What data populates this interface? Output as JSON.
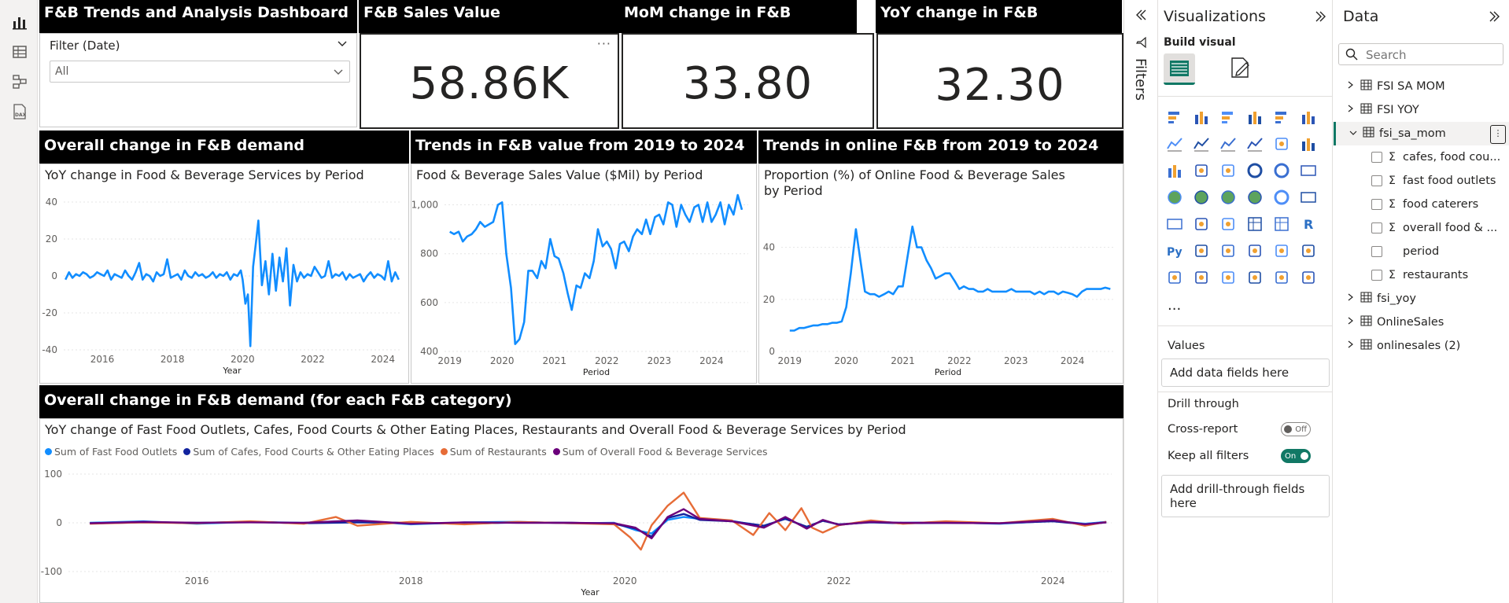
{
  "rail": {
    "icons": [
      "report-view-icon",
      "table-view-icon",
      "model-view-icon",
      "dax-query-icon"
    ]
  },
  "header": {
    "dashboard_title": "F&B Trends and Analysis Dashboard",
    "kpi1_title": "F&B Sales Value",
    "kpi2_title": "MoM change in F&B",
    "kpi3_title": "YoY change in F&B"
  },
  "filter": {
    "label": "Filter (Date)",
    "value": "All"
  },
  "kpis": {
    "sales_value": "58.86K",
    "mom": "33.80",
    "yoy": "32.30"
  },
  "sections": {
    "s1": "Overall change in F&B demand",
    "s2": "Trends in F&B value from 2019 to 2024",
    "s3": "Trends in online F&B from 2019 to 2024",
    "s4": "Overall change in F&B demand (for each F&B category)"
  },
  "chart_data": [
    {
      "type": "line",
      "title": "YoY change in Food & Beverage Services by Period",
      "xlabel": "Year",
      "ylabel": "",
      "x_ticks": [
        "2016",
        "2018",
        "2020",
        "2022",
        "2024"
      ],
      "y_ticks": [
        40,
        20,
        0,
        -20,
        -40
      ],
      "xlim": [
        2014.9,
        2024.5
      ],
      "ylim": [
        -40,
        40
      ],
      "grid": true,
      "series": [
        {
          "color": "#118DFF",
          "x": [
            2014.95,
            2015.05,
            2015.15,
            2015.25,
            2015.35,
            2015.45,
            2015.55,
            2015.65,
            2015.75,
            2015.85,
            2015.95,
            2016.05,
            2016.15,
            2016.25,
            2016.35,
            2016.45,
            2016.55,
            2016.65,
            2016.75,
            2016.85,
            2016.95,
            2017.05,
            2017.15,
            2017.25,
            2017.35,
            2017.45,
            2017.55,
            2017.65,
            2017.75,
            2017.85,
            2017.95,
            2018.05,
            2018.15,
            2018.25,
            2018.35,
            2018.45,
            2018.55,
            2018.65,
            2018.75,
            2018.85,
            2018.95,
            2019.05,
            2019.15,
            2019.25,
            2019.35,
            2019.45,
            2019.55,
            2019.65,
            2019.75,
            2019.85,
            2019.95,
            2020.0,
            2020.08,
            2020.15,
            2020.22,
            2020.3,
            2020.38,
            2020.45,
            2020.55,
            2020.65,
            2020.75,
            2020.85,
            2020.95,
            2021.05,
            2021.15,
            2021.25,
            2021.35,
            2021.45,
            2021.55,
            2021.65,
            2021.75,
            2021.85,
            2021.95,
            2022.05,
            2022.15,
            2022.25,
            2022.35,
            2022.45,
            2022.55,
            2022.65,
            2022.75,
            2022.85,
            2022.95,
            2023.05,
            2023.15,
            2023.25,
            2023.35,
            2023.45,
            2023.55,
            2023.65,
            2023.75,
            2023.85,
            2023.95,
            2024.05,
            2024.15,
            2024.25,
            2024.35,
            2024.45
          ],
          "y": [
            -2,
            2,
            -1,
            1,
            0,
            2,
            1,
            -1,
            0,
            2,
            1,
            0,
            3,
            -2,
            1,
            0,
            -1,
            3,
            0,
            -2,
            2,
            7,
            -2,
            1,
            0,
            -3,
            2,
            0,
            1,
            9,
            -1,
            0,
            1,
            -2,
            3,
            0,
            -1,
            2,
            0,
            1,
            -1,
            0,
            2,
            -1,
            1,
            0,
            2,
            -2,
            1,
            0,
            3,
            -2,
            -15,
            -10,
            -38,
            5,
            18,
            30,
            -5,
            8,
            -10,
            12,
            -8,
            10,
            -3,
            15,
            -16,
            6,
            -3,
            2,
            -1,
            1,
            0,
            5,
            2,
            -1,
            0,
            8,
            -1,
            1,
            0,
            2,
            -2,
            1,
            -1,
            0,
            1,
            -3,
            0,
            2,
            -1,
            1,
            0,
            -2,
            8,
            -3,
            2,
            -2
          ]
        }
      ]
    },
    {
      "type": "line",
      "title": "Food & Beverage Sales Value ($Mil) by Period",
      "xlabel": "Period",
      "ylabel": "",
      "x_ticks": [
        "2019",
        "2020",
        "2021",
        "2022",
        "2023",
        "2024"
      ],
      "y_ticks": [
        "1,000",
        "800",
        "600",
        "400"
      ],
      "xlim": [
        2018.9,
        2024.7
      ],
      "ylim": [
        400,
        1050
      ],
      "grid": true,
      "series": [
        {
          "color": "#118DFF",
          "x": [
            2019.0,
            2019.08,
            2019.17,
            2019.25,
            2019.33,
            2019.42,
            2019.5,
            2019.58,
            2019.67,
            2019.75,
            2019.83,
            2019.92,
            2020.0,
            2020.08,
            2020.17,
            2020.25,
            2020.33,
            2020.42,
            2020.5,
            2020.58,
            2020.67,
            2020.75,
            2020.83,
            2020.92,
            2021.0,
            2021.08,
            2021.17,
            2021.25,
            2021.33,
            2021.42,
            2021.5,
            2021.58,
            2021.67,
            2021.75,
            2021.83,
            2021.92,
            2022.0,
            2022.08,
            2022.17,
            2022.25,
            2022.33,
            2022.42,
            2022.5,
            2022.58,
            2022.67,
            2022.75,
            2022.83,
            2022.92,
            2023.0,
            2023.08,
            2023.17,
            2023.25,
            2023.33,
            2023.42,
            2023.5,
            2023.58,
            2023.67,
            2023.75,
            2023.83,
            2023.92,
            2024.0,
            2024.08,
            2024.17,
            2024.25,
            2024.33,
            2024.42,
            2024.5,
            2024.58
          ],
          "y": [
            890,
            880,
            890,
            850,
            870,
            880,
            900,
            930,
            910,
            920,
            930,
            1000,
            1010,
            800,
            660,
            430,
            450,
            520,
            730,
            730,
            700,
            770,
            740,
            860,
            790,
            780,
            720,
            640,
            570,
            670,
            660,
            720,
            700,
            770,
            900,
            830,
            850,
            820,
            740,
            840,
            850,
            810,
            870,
            900,
            880,
            940,
            880,
            950,
            960,
            920,
            1010,
            1000,
            910,
            1000,
            960,
            930,
            990,
            1000,
            930,
            1010,
            930,
            960,
            1010,
            920,
            1000,
            960,
            1040,
            980
          ]
        }
      ]
    },
    {
      "type": "line",
      "title": "Proportion (%) of Online Food & Beverage Sales by Period",
      "xlabel": "Period",
      "ylabel": "",
      "x_ticks": [
        "2019",
        "2020",
        "2021",
        "2022",
        "2023",
        "2024"
      ],
      "y_ticks": [
        40,
        20,
        0
      ],
      "xlim": [
        2018.85,
        2024.75
      ],
      "ylim": [
        0,
        55
      ],
      "grid": true,
      "series": [
        {
          "color": "#118DFF",
          "x": [
            2019.0,
            2019.08,
            2019.17,
            2019.25,
            2019.33,
            2019.42,
            2019.5,
            2019.58,
            2019.67,
            2019.75,
            2019.83,
            2019.92,
            2020.0,
            2020.08,
            2020.17,
            2020.25,
            2020.33,
            2020.42,
            2020.5,
            2020.58,
            2020.67,
            2020.75,
            2020.83,
            2020.92,
            2021.0,
            2021.08,
            2021.17,
            2021.25,
            2021.33,
            2021.42,
            2021.5,
            2021.58,
            2021.67,
            2021.75,
            2021.83,
            2021.92,
            2022.0,
            2022.08,
            2022.17,
            2022.25,
            2022.33,
            2022.42,
            2022.5,
            2022.58,
            2022.67,
            2022.75,
            2022.83,
            2022.92,
            2023.0,
            2023.08,
            2023.17,
            2023.25,
            2023.33,
            2023.42,
            2023.5,
            2023.58,
            2023.67,
            2023.75,
            2023.83,
            2023.92,
            2024.0,
            2024.08,
            2024.17,
            2024.25,
            2024.33,
            2024.42,
            2024.5,
            2024.58,
            2024.67
          ],
          "y": [
            8,
            8,
            9,
            9,
            9.5,
            10,
            10,
            10.5,
            10.5,
            11,
            11,
            11.5,
            17,
            30,
            47,
            35,
            23,
            22,
            22,
            21,
            22,
            23,
            22,
            25,
            25,
            36,
            48,
            40,
            40,
            35,
            32,
            28,
            29,
            30,
            30,
            27,
            24,
            25,
            24,
            24,
            23,
            23,
            24,
            23,
            23,
            23,
            23,
            24,
            23,
            23,
            23,
            23,
            22,
            23,
            22,
            23,
            23,
            22,
            23,
            22.5,
            22,
            21,
            23,
            24,
            24,
            24,
            24,
            24.5,
            24
          ]
        }
      ]
    },
    {
      "type": "line",
      "title": "YoY change of Fast Food Outlets, Cafes, Food Courts & Other Eating Places, Restaurants and Overall Food & Beverage Services by Period",
      "xlabel": "Year",
      "ylabel": "",
      "x_ticks": [
        "2016",
        "2018",
        "2020",
        "2022",
        "2024"
      ],
      "y_ticks": [
        100,
        0,
        -100
      ],
      "xlim": [
        2014.8,
        2024.55
      ],
      "ylim": [
        -100,
        100
      ],
      "grid": true,
      "series": [
        {
          "name": "Sum of Fast Food Outlets",
          "color": "#118DFF",
          "x": [
            2015.0,
            2015.5,
            2016.0,
            2016.5,
            2017.0,
            2017.5,
            2018.0,
            2018.5,
            2019.0,
            2019.5,
            2019.9,
            2020.1,
            2020.25,
            2020.4,
            2020.55,
            2020.7,
            2021.0,
            2021.3,
            2021.5,
            2021.7,
            2021.85,
            2022.0,
            2022.3,
            2022.6,
            2023.0,
            2023.5,
            2024.0,
            2024.3,
            2024.5
          ],
          "y": [
            0,
            3,
            -2,
            2,
            0,
            4,
            -3,
            1,
            2,
            -1,
            0,
            -15,
            -22,
            6,
            12,
            8,
            4,
            -8,
            10,
            -10,
            5,
            -4,
            2,
            0,
            1,
            -2,
            4,
            -2,
            2
          ]
        },
        {
          "name": "Sum of Cafes, Food Courts & Other Eating Places",
          "color": "#12239E",
          "x": [
            2015.0,
            2015.5,
            2016.0,
            2016.5,
            2017.0,
            2017.5,
            2018.0,
            2018.5,
            2019.0,
            2019.5,
            2019.9,
            2020.1,
            2020.25,
            2020.4,
            2020.55,
            2020.7,
            2021.0,
            2021.3,
            2021.5,
            2021.7,
            2021.85,
            2022.0,
            2022.3,
            2022.6,
            2023.0,
            2023.5,
            2024.0,
            2024.3,
            2024.5
          ],
          "y": [
            -1,
            1,
            0,
            2,
            -1,
            1,
            0,
            -2,
            1,
            0,
            -2,
            -12,
            -28,
            10,
            18,
            6,
            3,
            -6,
            8,
            -8,
            4,
            -3,
            1,
            -1,
            0,
            -1,
            3,
            -3,
            1
          ]
        },
        {
          "name": "Sum of Restaurants",
          "color": "#E66C37",
          "x": [
            2015.0,
            2015.5,
            2016.0,
            2016.5,
            2017.0,
            2017.3,
            2017.5,
            2018.0,
            2018.5,
            2019.0,
            2019.5,
            2019.9,
            2020.05,
            2020.15,
            2020.25,
            2020.4,
            2020.55,
            2020.7,
            2021.0,
            2021.2,
            2021.35,
            2021.5,
            2021.65,
            2021.75,
            2021.85,
            2022.0,
            2022.3,
            2022.6,
            2023.0,
            2023.5,
            2024.0,
            2024.3,
            2024.5
          ],
          "y": [
            -2,
            1,
            -1,
            3,
            -2,
            12,
            -6,
            2,
            -3,
            2,
            -1,
            -3,
            -30,
            -55,
            -5,
            35,
            62,
            10,
            5,
            -25,
            20,
            -15,
            30,
            -10,
            -20,
            -5,
            5,
            -2,
            3,
            -1,
            8,
            -6,
            2
          ]
        },
        {
          "name": "Sum of Overall Food & Beverage Services",
          "color": "#6B007B",
          "x": [
            2015.0,
            2015.5,
            2016.0,
            2016.5,
            2017.0,
            2017.5,
            2018.0,
            2018.5,
            2019.0,
            2019.5,
            2019.9,
            2020.1,
            2020.25,
            2020.4,
            2020.55,
            2020.7,
            2021.0,
            2021.3,
            2021.5,
            2021.7,
            2021.85,
            2022.0,
            2022.3,
            2022.6,
            2023.0,
            2023.5,
            2024.0,
            2024.3,
            2024.5
          ],
          "y": [
            -1,
            2,
            0,
            1,
            0,
            5,
            -2,
            1,
            0,
            0,
            -1,
            -10,
            -32,
            12,
            28,
            8,
            3,
            -10,
            12,
            -12,
            6,
            -4,
            2,
            0,
            0,
            -1,
            5,
            -3,
            1
          ]
        }
      ]
    }
  ],
  "legend": {
    "items": [
      "Sum of Fast Food Outlets",
      "Sum of Cafes, Food Courts & Other Eating Places",
      "Sum of Restaurants",
      "Sum of Overall Food & Beverage Services"
    ],
    "colors": [
      "#118DFF",
      "#12239E",
      "#E66C37",
      "#6B007B"
    ]
  },
  "filters_pane": {
    "label": "Filters"
  },
  "visualizations": {
    "title": "Visualizations",
    "build_visual": "Build visual",
    "values_label": "Values",
    "values_placeholder": "Add data fields here",
    "drill_through": "Drill through",
    "cross_report": "Cross-report",
    "cross_report_state": "Off",
    "keep_all_filters": "Keep all filters",
    "keep_all_filters_state": "On",
    "drill_placeholder": "Add drill-through fields here",
    "more": "..."
  },
  "data_pane": {
    "title": "Data",
    "search_placeholder": "Search",
    "tables": [
      {
        "name": "FSI SA MOM",
        "expanded": false
      },
      {
        "name": "FSI YOY",
        "expanded": false
      },
      {
        "name": "fsi_sa_mom",
        "expanded": true
      },
      {
        "name": "fsi_yoy",
        "expanded": false
      },
      {
        "name": "OnlineSales",
        "expanded": false
      },
      {
        "name": "onlinesales (2)",
        "expanded": false
      }
    ],
    "fields": [
      {
        "name": "cafes, food cou...",
        "sigma": true
      },
      {
        "name": "fast food outlets",
        "sigma": true
      },
      {
        "name": "food caterers",
        "sigma": true
      },
      {
        "name": "overall food & ...",
        "sigma": true
      },
      {
        "name": "period",
        "sigma": false
      },
      {
        "name": "restaurants",
        "sigma": true
      }
    ]
  }
}
